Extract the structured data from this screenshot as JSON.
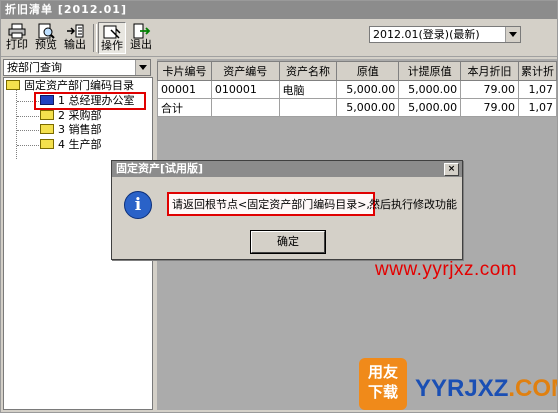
{
  "window": {
    "title": "折旧清单 [2012.01]"
  },
  "toolbar": {
    "buttons": [
      {
        "label": "打印",
        "icon": "printer-icon"
      },
      {
        "label": "预览",
        "icon": "preview-icon"
      },
      {
        "label": "输出",
        "icon": "export-icon"
      },
      {
        "label": "操作",
        "icon": "operate-icon"
      },
      {
        "label": "退出",
        "icon": "exit-icon"
      }
    ],
    "period_select": "2012.01(登录)(最新)"
  },
  "left_panel": {
    "query_select": "按部门查询",
    "tree": {
      "root": "固定资产部门编码目录",
      "children": [
        "1 总经理办公室",
        "2 采购部",
        "3 销售部",
        "4 生产部"
      ]
    }
  },
  "grid": {
    "columns": [
      "卡片编号",
      "资产编号",
      "资产名称",
      "原值",
      "计提原值",
      "本月折旧",
      "累计折"
    ],
    "rows": [
      [
        "00001",
        "010001",
        "电脑",
        "5,000.00",
        "5,000.00",
        "79.00",
        "1,07"
      ],
      [
        "合计",
        "",
        "",
        "5,000.00",
        "5,000.00",
        "79.00",
        "1,07"
      ]
    ]
  },
  "dialog": {
    "title": "固定资产[试用版]",
    "message_highlight": "请返回根节点<固定资产部门编码目录>,",
    "message_rest": "然后执行修改功能",
    "ok_label": "确定",
    "close_glyph": "×",
    "info_glyph": "i"
  },
  "watermark": {
    "url": "www.yyrjxz.com",
    "logo_line1": "用友",
    "logo_line2": "下载",
    "brand": "YYRJXZ",
    "brand_suffix": ".COM"
  }
}
